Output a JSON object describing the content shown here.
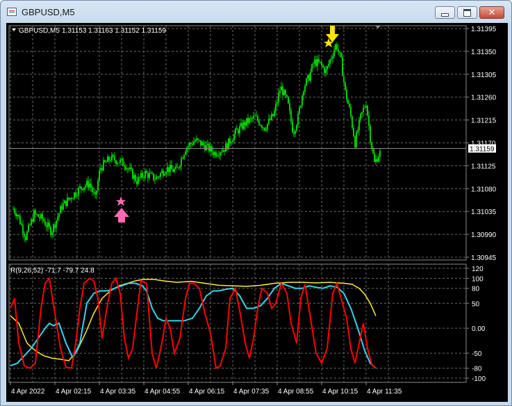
{
  "window": {
    "title": "GBPUSD,M5"
  },
  "main_chart": {
    "symbol_label": "GBPUSD,M5",
    "ohlc_label": "1.31153 1.31163 1.31152 1.31159",
    "current_price_label": "1.31159",
    "current_price": 1.31159,
    "y_ticks": [
      "1.31395",
      "1.31350",
      "1.31305",
      "1.31260",
      "1.31215",
      "1.31170",
      "1.31125",
      "1.31080",
      "1.31035",
      "1.30990",
      "1.30945"
    ],
    "y_range": [
      1.30945,
      1.31395
    ],
    "candle_color": "#00cc00",
    "buy_signal_color": "#ff69b4",
    "sell_signal_color": "#ffe600",
    "buy_signal_icon": "up-arrow-icon",
    "sell_signal_icon": "down-arrow-icon"
  },
  "indicator": {
    "label": "R(9,26,52) -71.7 -79.7 24.8",
    "y_ticks": [
      "120",
      "100",
      "80",
      "50",
      "0.00",
      "-50",
      "-80",
      "-100"
    ],
    "y_range": [
      -100,
      120
    ],
    "line_colors": [
      "#ff0000",
      "#33d6ef",
      "#ffee33"
    ]
  },
  "x_axis": {
    "labels": [
      "4 Apr 2022",
      "4 Apr 02:15",
      "4 Apr 03:35",
      "4 Apr 04:55",
      "4 Apr 06:15",
      "4 Apr 07:35",
      "4 Apr 08:55",
      "4 Apr 10:15",
      "4 Apr 11:35"
    ]
  }
}
